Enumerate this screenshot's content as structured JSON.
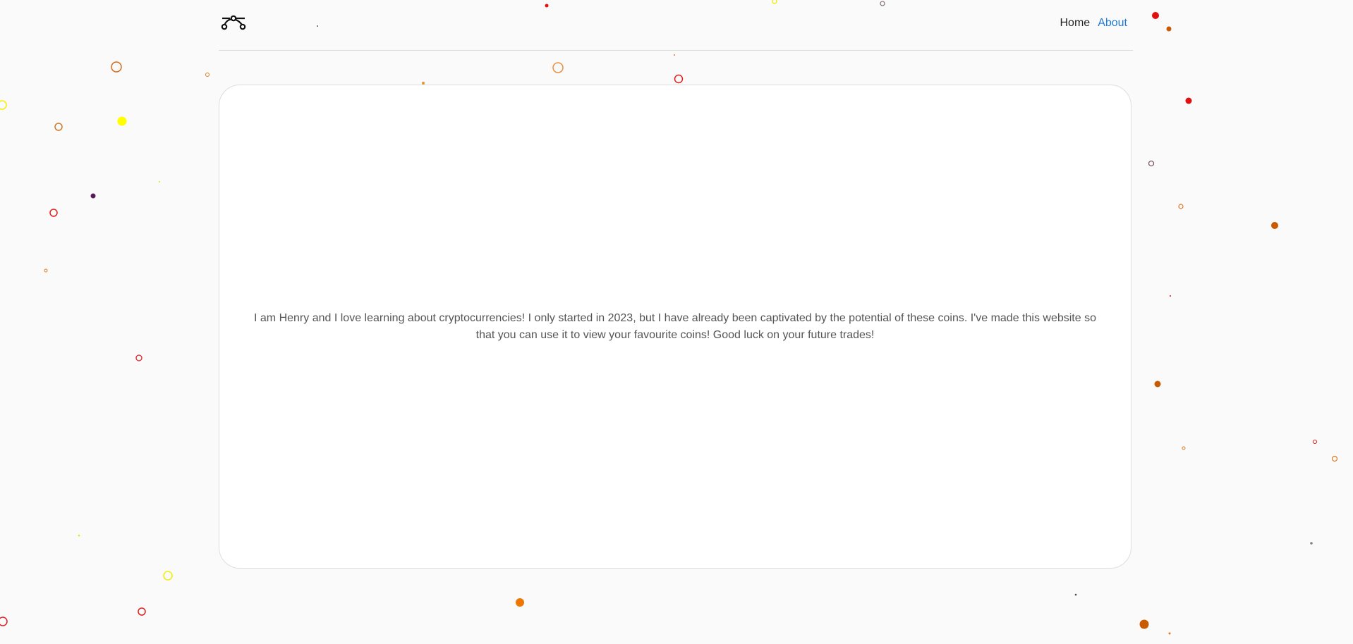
{
  "nav": {
    "logo_icon": "bezier-curve-icon",
    "links": [
      {
        "label": "Home",
        "active": false
      },
      {
        "label": "About",
        "active": true
      }
    ],
    "active_color": "#1f7ad6"
  },
  "about": {
    "text": "I am Henry and I love learning about cryptocurrencies! I only started in 2023, but I have already been captivated by the potential of these coins. I've made this website so that you can use it to view your favourite coins! Good luck on your future trades!"
  },
  "background": {
    "color": "#fafafa",
    "particle_colors": [
      "#ff0000",
      "#e06000",
      "#c85a00",
      "#ffff00",
      "#9a8c8c",
      "#5a1a5a",
      "#ee7700"
    ]
  }
}
